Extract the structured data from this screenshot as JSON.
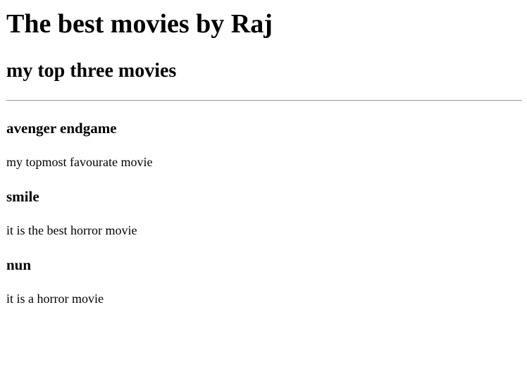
{
  "page": {
    "title": "The best movies by Raj",
    "subtitle": "my top three movies"
  },
  "movies": [
    {
      "title": "avenger endgame",
      "description": "my topmost favourate movie"
    },
    {
      "title": "smile",
      "description": "it is the best horror movie"
    },
    {
      "title": "nun",
      "description": "it is a horror movie"
    }
  ]
}
